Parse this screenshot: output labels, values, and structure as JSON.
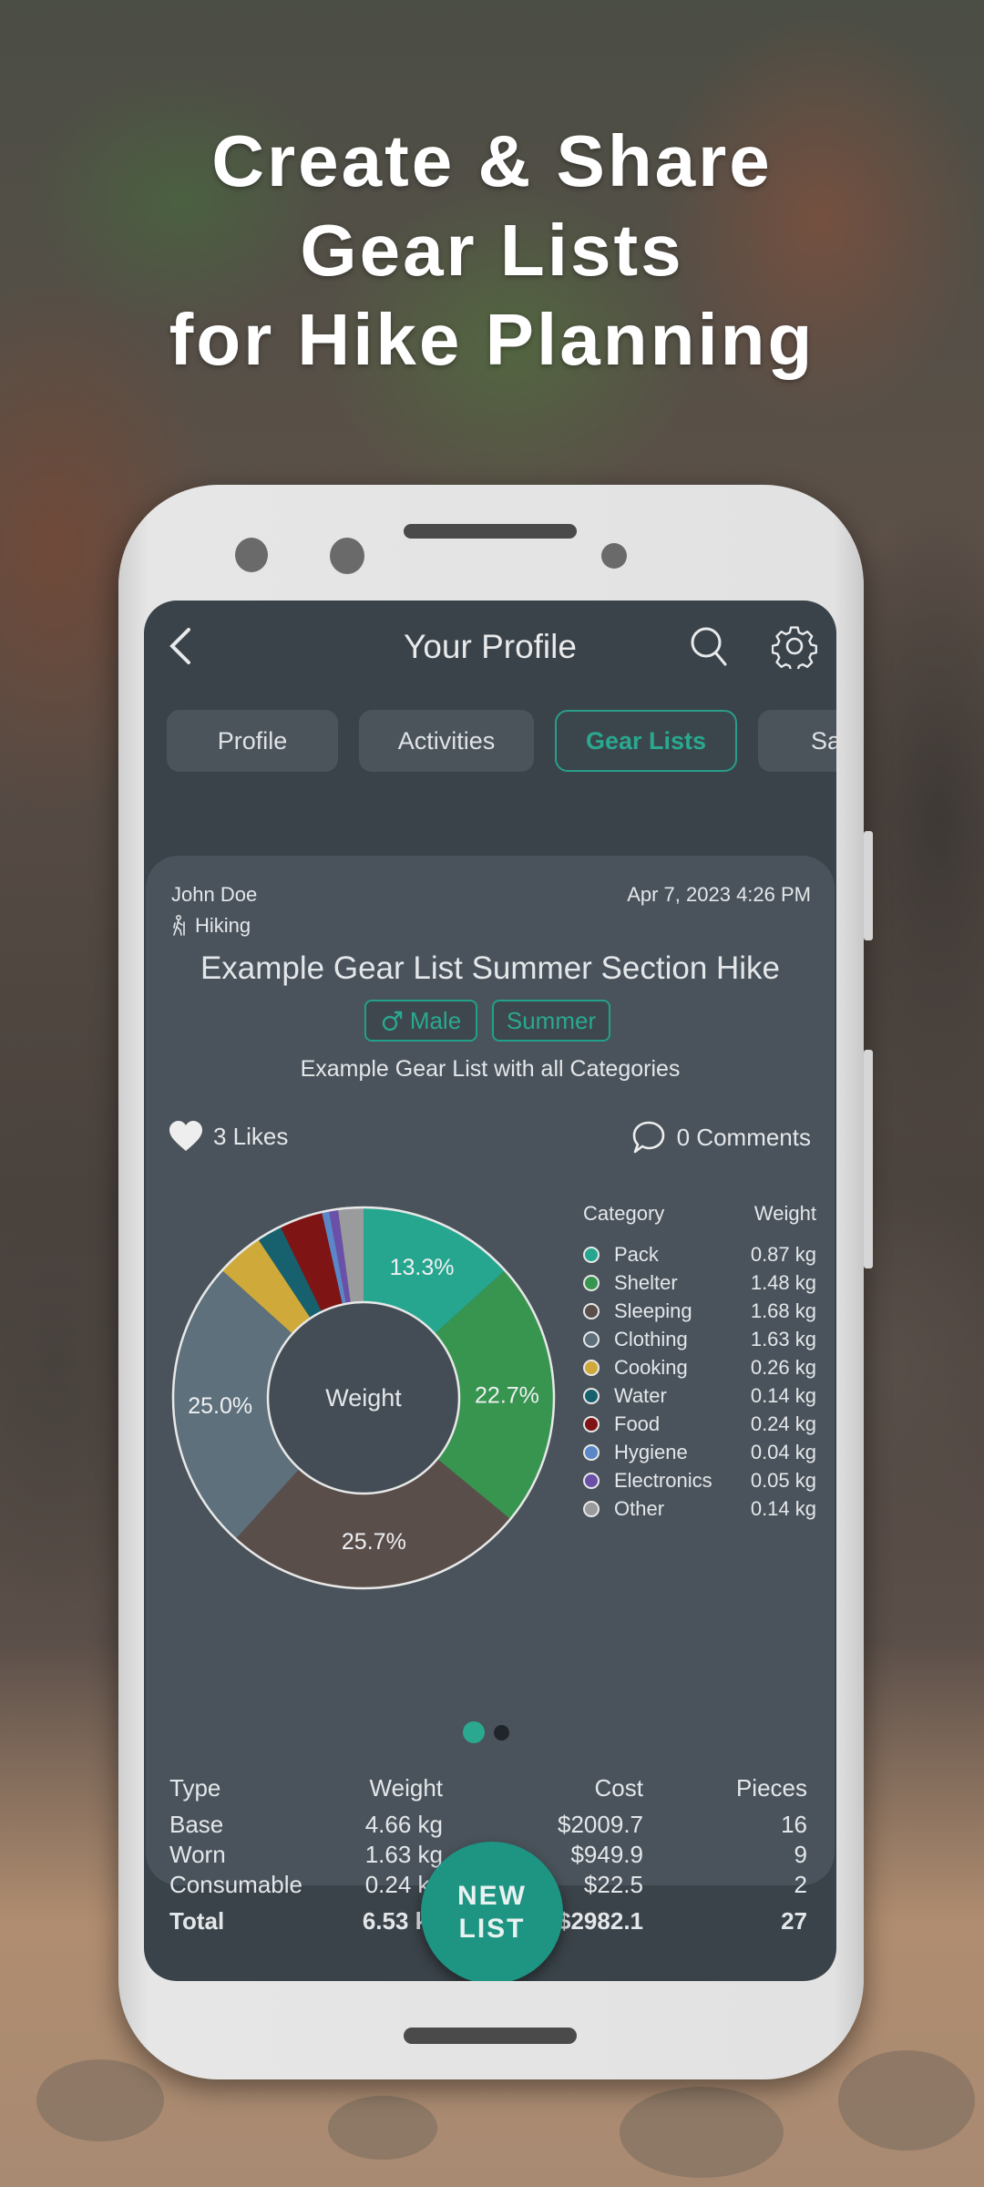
{
  "promo": {
    "headline_lines": [
      "Create & Share",
      "Gear Lists",
      "for Hike Planning"
    ]
  },
  "app": {
    "title": "Your Profile",
    "back_icon": "chevron-left-icon",
    "search_icon": "search-icon",
    "settings_icon": "gear-icon",
    "tabs": [
      {
        "label": "Profile",
        "active": false
      },
      {
        "label": "Activities",
        "active": false
      },
      {
        "label": "Gear Lists",
        "active": true
      },
      {
        "label": "Sa",
        "active": false
      }
    ],
    "accent_color": "#2aa890"
  },
  "gear_list": {
    "author": "John Doe",
    "activity": "Hiking",
    "activity_icon": "hiker-icon",
    "date": "Apr 7, 2023 4:26 PM",
    "title": "Example Gear List Summer Section Hike",
    "tags": [
      {
        "label": "Male",
        "icon": "male-icon"
      },
      {
        "label": "Summer"
      }
    ],
    "description": "Example Gear List with all Categories",
    "likes": "3 Likes",
    "comments": "0 Comments",
    "pager": {
      "pages": 2,
      "current": 1
    }
  },
  "chart_data": {
    "type": "pie",
    "variant": "donut",
    "title": "Weight",
    "unit": "kg",
    "legend_header": {
      "category": "Category",
      "weight": "Weight"
    },
    "legend_position": "right",
    "categories": [
      "Pack",
      "Shelter",
      "Sleeping",
      "Clothing",
      "Cooking",
      "Water",
      "Food",
      "Hygiene",
      "Electronics",
      "Other"
    ],
    "values": [
      0.87,
      1.48,
      1.68,
      1.63,
      0.26,
      0.14,
      0.24,
      0.04,
      0.05,
      0.14
    ],
    "value_labels": [
      "0.87 kg",
      "1.48 kg",
      "1.68 kg",
      "1.63 kg",
      "0.26 kg",
      "0.14 kg",
      "0.24 kg",
      "0.04 kg",
      "0.05 kg",
      "0.14 kg"
    ],
    "colors": [
      "#26a68f",
      "#379550",
      "#5a4e4b",
      "#5d707b",
      "#cfaa3a",
      "#17606e",
      "#7e1414",
      "#5b86c8",
      "#6a50a8",
      "#9a9b9c"
    ],
    "slice_labels": {
      "Pack": "13.3%",
      "Shelter": "22.7%",
      "Sleeping": "25.7%",
      "Clothing": "25.0%"
    }
  },
  "summary_table": {
    "headers": [
      "Type",
      "Weight",
      "Cost",
      "Pieces"
    ],
    "rows": [
      [
        "Base",
        "4.66 kg",
        "$2009.7",
        "16"
      ],
      [
        "Worn",
        "1.63 kg",
        "$949.9",
        "9"
      ],
      [
        "Consumable",
        "0.24 kg",
        "$22.5",
        "2"
      ]
    ],
    "total": [
      "Total",
      "6.53 kg",
      "$2982.1",
      "27"
    ]
  },
  "fab": {
    "line1": "NEW",
    "line2": "LIST"
  }
}
